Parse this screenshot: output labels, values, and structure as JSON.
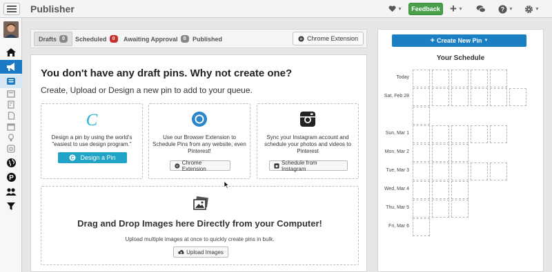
{
  "header": {
    "title": "Publisher",
    "feedback_label": "Feedback"
  },
  "tabs": [
    {
      "label": "Drafts",
      "count": "0",
      "badge_color": "#888888",
      "active": true
    },
    {
      "label": "Scheduled",
      "count": "0",
      "badge_color": "#c9302c",
      "active": false
    },
    {
      "label": "Awaiting Approval",
      "count": "0",
      "badge_color": "#888888",
      "active": false
    },
    {
      "label": "Published",
      "count": "",
      "active": false
    }
  ],
  "chrome_extension_top": "Chrome Extension",
  "main": {
    "heading": "You don't have any draft pins. Why not create one?",
    "subheading": "Create, Upload or Design a new pin to add to your queue.",
    "cards": [
      {
        "icon": "canva-logo-icon",
        "text": "Design a pin by using the world's \"easiest to use design program.\"",
        "button": "Design a Pin"
      },
      {
        "icon": "chrome-logo-icon",
        "text": "Use our Browser Extension to Schedule Pins from any website, even Pinterest!",
        "button": "Chrome Extension"
      },
      {
        "icon": "instagram-icon",
        "text": "Sync your Instagram account and schedule your photos and videos to Pinterest",
        "button": "Schedule from Instagram"
      }
    ],
    "dropzone": {
      "title": "Drag and Drop Images here Directly from your Computer!",
      "subtitle": "Upload multiple images at once to quickly create pins in bulk.",
      "button": "Upload Images"
    }
  },
  "schedule": {
    "create_button": "Create New Pin",
    "title": "Your Schedule",
    "days": [
      {
        "label": "Today",
        "rows": 1,
        "slots": [
          5
        ]
      },
      {
        "label": "Sat, Feb 28",
        "rows": 2,
        "slots": [
          6,
          1
        ]
      },
      {
        "label": "Sun, Mar 1",
        "rows": 1,
        "slots": [
          5
        ]
      },
      {
        "label": "Mon, Mar 2",
        "rows": 1,
        "slots": [
          3
        ]
      },
      {
        "label": "Tue, Mar 3",
        "rows": 1,
        "slots": [
          5
        ]
      },
      {
        "label": "Wed, Mar 4",
        "rows": 1,
        "slots": [
          3
        ]
      },
      {
        "label": "Thu, Mar 5",
        "rows": 1,
        "slots": [
          3
        ]
      },
      {
        "label": "Fri, Mar 6",
        "rows": 1,
        "slots": [
          1
        ]
      }
    ]
  },
  "colors": {
    "accent_blue": "#1b7fc4",
    "canva_teal": "#20a3c7",
    "feedback_green": "#4aa04a"
  }
}
